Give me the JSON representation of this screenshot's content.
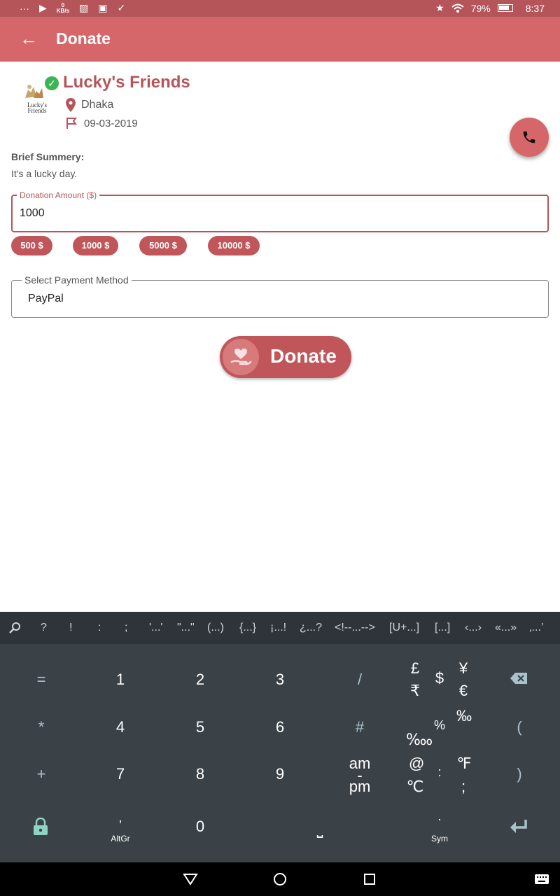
{
  "status_bar": {
    "left_icons": [
      "more-icon",
      "play-icon",
      "data-speed-icon",
      "image-icon",
      "flipboard-icon",
      "check-icon"
    ],
    "data_speed_value": "0",
    "data_speed_unit": "KB/s",
    "battery": "79%",
    "time": "8:37"
  },
  "appbar": {
    "title": "Donate",
    "back_icon": "arrow-back-icon"
  },
  "org": {
    "name": "Lucky's Friends",
    "logo_text": "Lucky's Friends",
    "location": "Dhaka",
    "date": "09-03-2019",
    "verified": true
  },
  "summary": {
    "label": "Brief Summery:",
    "text": "It's a lucky day."
  },
  "amount": {
    "legend": "Donation Amount ($)",
    "value": "1000",
    "chips": [
      "500 $",
      "1000 $",
      "5000 $",
      "10000 $"
    ]
  },
  "payment": {
    "legend": "Select Payment Method",
    "value": "PayPal"
  },
  "donate_button": {
    "label": "Donate"
  },
  "keyboard": {
    "suggestions": [
      "?",
      "!",
      ":",
      ";",
      "'...'",
      "\"...\"",
      "(...)",
      "{...}",
      "¡...!",
      "¿...?",
      "<!--...-->",
      "[U+...]",
      "[...]",
      "‹...›",
      "«...»",
      "‚...’"
    ],
    "row1": [
      "=",
      "1",
      "2",
      "3",
      "/",
      "$",
      ""
    ],
    "row1_currency": [
      "£",
      "₹",
      "¥",
      "€"
    ],
    "row2": [
      "*",
      "4",
      "5",
      "6",
      "#",
      "%",
      "("
    ],
    "row2_extra": [
      "‰",
      "‱"
    ],
    "row3": [
      "+",
      "7",
      "8",
      "9",
      "",
      ":",
      ")"
    ],
    "row3_time": [
      "am",
      "-",
      "pm"
    ],
    "row3_extra": [
      "@",
      "℃",
      "℉",
      ";"
    ],
    "row4_comma": ",",
    "row4_altgr": "AltGr",
    "row4_zero": "0",
    "row4_dot": ".",
    "row4_sym": "Sym"
  },
  "colors": {
    "primary": "#d5676a",
    "dark": "#b5555a",
    "chip": "#c0555a"
  }
}
